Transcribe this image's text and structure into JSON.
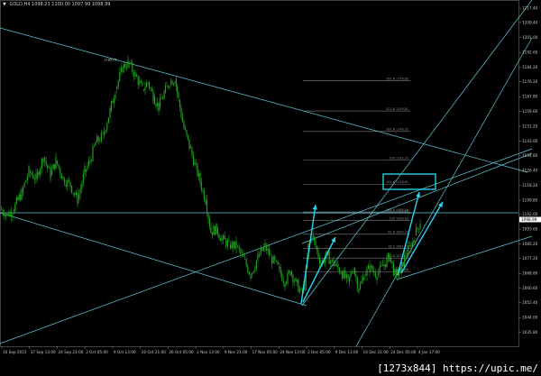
{
  "header": {
    "symbol_info": "GOLD,H4  1098.23 1100.00 1097.99 1098.99",
    "menu_glyph": "▼"
  },
  "watermark": "[1273x844] https://upic.me/",
  "colors": {
    "background": "#000000",
    "candles": "#1e9e1e",
    "lines": "#5fc9d8",
    "arrows": "#2bd3f0",
    "fib": "#7f7f7f",
    "text": "#c8c8c8",
    "price_tag": "#ffffff"
  },
  "chart_data": {
    "type": "candlestick",
    "ylim": [
      1028,
      1222
    ],
    "y_ticks": [
      "1217.40",
      "1209.40",
      "1201.00",
      "1192.60",
      "1184.20",
      "1176.20",
      "1167.80",
      "1159.60",
      "1151.20",
      "1143.00",
      "1134.80",
      "1126.40",
      "1118.20",
      "1109.80",
      "1102.00",
      "1093.60",
      "1085.20",
      "1077.20",
      "1068.80",
      "1060.60",
      "1052.40",
      "1044.00",
      "1035.80",
      "1027.40"
    ],
    "x_ticks": [
      "10 Sep 2015",
      "17 Sep 13:00",
      "24 Sep 21:00",
      "2 Oct 05:00",
      "9 Oct 13:00",
      "16 Oct 21:00",
      "26 Oct 05:00",
      "2 Nov 13:00",
      "9 Nov 21:00",
      "17 Nov 05:00",
      "24 Nov 13:00",
      "2 Dec 05:00",
      "9 Dec 13:00",
      "16 Dec 21:00",
      "24 Dec 05:00",
      "4 Jan 17:00"
    ],
    "price_path": [
      [
        0,
        1105
      ],
      [
        8,
        1102
      ],
      [
        14,
        1104
      ],
      [
        24,
        1114
      ],
      [
        32,
        1126
      ],
      [
        40,
        1122
      ],
      [
        48,
        1134
      ],
      [
        56,
        1124
      ],
      [
        62,
        1132
      ],
      [
        70,
        1122
      ],
      [
        78,
        1118
      ],
      [
        86,
        1110
      ],
      [
        94,
        1126
      ],
      [
        100,
        1132
      ],
      [
        106,
        1142
      ],
      [
        114,
        1146
      ],
      [
        122,
        1160
      ],
      [
        128,
        1172
      ],
      [
        136,
        1184
      ],
      [
        142,
        1187
      ],
      [
        150,
        1180
      ],
      [
        158,
        1172
      ],
      [
        164,
        1176
      ],
      [
        170,
        1168
      ],
      [
        176,
        1162
      ],
      [
        182,
        1170
      ],
      [
        188,
        1176
      ],
      [
        194,
        1178
      ],
      [
        198,
        1166
      ],
      [
        204,
        1150
      ],
      [
        210,
        1140
      ],
      [
        216,
        1130
      ],
      [
        222,
        1120
      ],
      [
        228,
        1110
      ],
      [
        234,
        1092
      ],
      [
        240,
        1094
      ],
      [
        246,
        1088
      ],
      [
        254,
        1085
      ],
      [
        262,
        1084
      ],
      [
        270,
        1077
      ],
      [
        278,
        1068
      ],
      [
        286,
        1078
      ],
      [
        294,
        1084
      ],
      [
        300,
        1078
      ],
      [
        308,
        1072
      ],
      [
        316,
        1064
      ],
      [
        322,
        1070
      ],
      [
        328,
        1064
      ],
      [
        334,
        1058
      ],
      [
        338,
        1062
      ],
      [
        342,
        1084
      ],
      [
        346,
        1090
      ],
      [
        350,
        1084
      ],
      [
        356,
        1074
      ],
      [
        362,
        1079
      ],
      [
        370,
        1074
      ],
      [
        378,
        1070
      ],
      [
        386,
        1064
      ],
      [
        392,
        1072
      ],
      [
        398,
        1060
      ],
      [
        404,
        1068
      ],
      [
        410,
        1072
      ],
      [
        418,
        1068
      ],
      [
        426,
        1074
      ],
      [
        432,
        1078
      ],
      [
        438,
        1068
      ],
      [
        444,
        1070
      ],
      [
        450,
        1080
      ],
      [
        456,
        1084
      ],
      [
        460,
        1090
      ],
      [
        466,
        1098
      ]
    ],
    "peak_label": "1189.01",
    "fib_levels": [
      {
        "label": "261.8  1176.69",
        "price": 1176.69
      },
      {
        "label": "423.6  1159.81",
        "price": 1159.81
      },
      {
        "label": "361.8  1148.35",
        "price": 1148.35
      },
      {
        "label": "200  1132.20",
        "price": 1132.2
      },
      {
        "label": "161.8  1118.81",
        "price": 1118.81
      },
      {
        "label": "138.2  1102.63",
        "price": 1102.63
      },
      {
        "label": "127.2  1103.24",
        "price": 1103.24
      },
      {
        "label": "100  1098.40",
        "price": 1098.4
      },
      {
        "label": "61.8  1090.72",
        "price": 1090.72
      },
      {
        "label": "38.2  1082.80",
        "price": 1082.8
      },
      {
        "label": "23.6  1077.43",
        "price": 1077.43
      },
      {
        "label": "0  1069.68",
        "price": 1069.68
      }
    ],
    "current_price": "1098.99"
  }
}
